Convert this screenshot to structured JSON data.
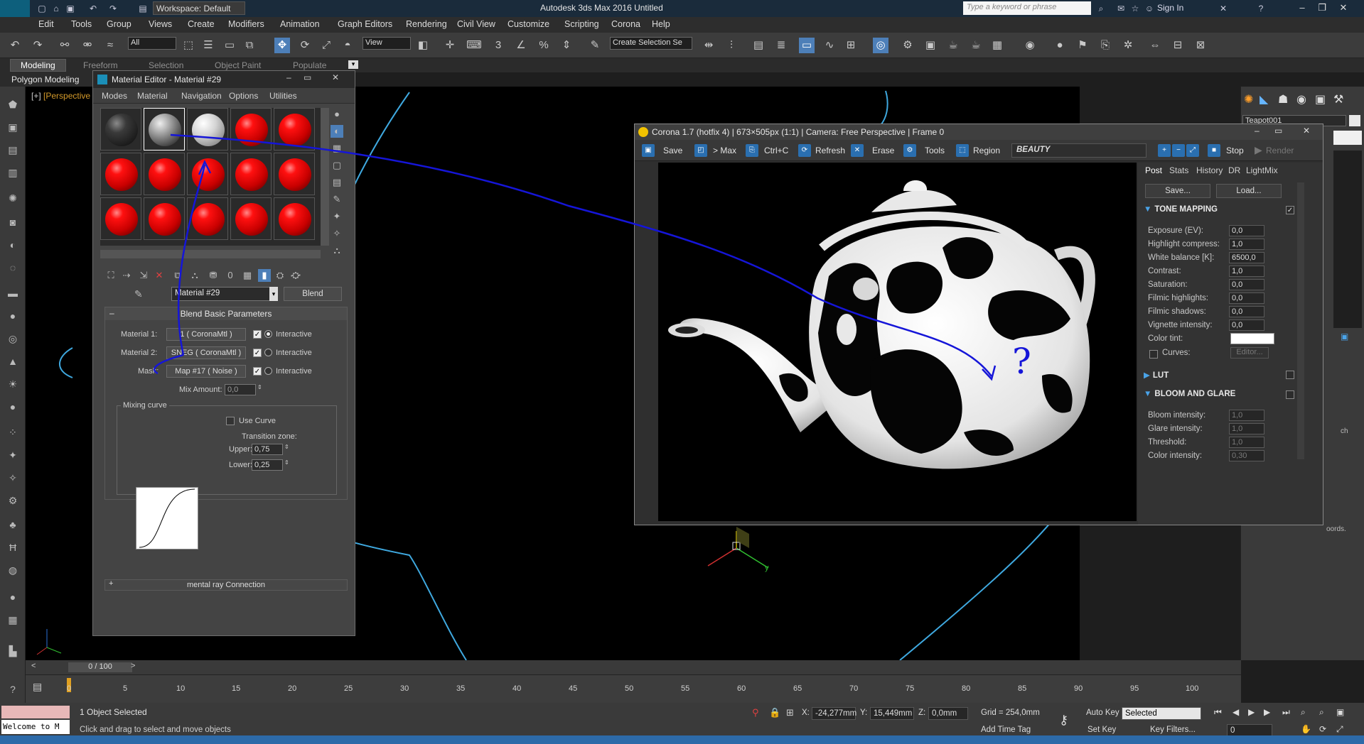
{
  "app": {
    "title": "Autodesk 3ds Max 2016     Untitled",
    "workspace": "Workspace: Default",
    "search_placeholder": "Type a keyword or phrase",
    "sign_in": "Sign In",
    "logo": "MAX"
  },
  "menu": [
    "Edit",
    "Tools",
    "Group",
    "Views",
    "Create",
    "Modifiers",
    "Animation",
    "Graph Editors",
    "Rendering",
    "Civil View",
    "Customize",
    "Scripting",
    "Corona",
    "Help"
  ],
  "toolbar": {
    "filter": "All",
    "ref_coord": "View",
    "selection_set": "Create Selection Se"
  },
  "ribbon": {
    "tabs": [
      "Modeling",
      "Freeform",
      "Selection",
      "Object Paint",
      "Populate"
    ],
    "active": "Modeling",
    "sub": "Polygon Modeling"
  },
  "viewport": {
    "bracket": "[+]",
    "label": "[Perspective",
    "gizmo_axis": "y"
  },
  "command_panel": {
    "object_name": "Teapot001",
    "side_text": "ch",
    "side_text2": "oords."
  },
  "material_editor": {
    "title": "Material Editor - Material #29",
    "menu": [
      "Modes",
      "Material",
      "Navigation",
      "Options",
      "Utilities"
    ],
    "material_name": "Material #29",
    "material_type": "Blend",
    "rollout_title": "Blend Basic Parameters",
    "material1_label": "Material 1:",
    "material1_value": "1  ( CoronaMtl )",
    "material2_label": "Material 2:",
    "material2_value": "SNEG  ( CoronaMtl )",
    "mask_label": "Mask:",
    "mask_value": "Map #17  ( Noise )",
    "interactive": "Interactive",
    "mix_amount_label": "Mix Amount:",
    "mix_amount": "0,0",
    "mixing_curve_label": "Mixing curve",
    "use_curve": "Use Curve",
    "transition_zone": "Transition zone:",
    "upper_label": "Upper:",
    "upper": "0,75",
    "lower_label": "Lower:",
    "lower": "0,25",
    "mental_ray": "mental ray Connection",
    "slots": [
      "dark",
      "noise",
      "white",
      "red",
      "red",
      "red",
      "red",
      "red",
      "red",
      "red",
      "red",
      "red",
      "red",
      "red",
      "red"
    ]
  },
  "vfb": {
    "title": "Corona 1.7 (hotfix 4) | 673×505px (1:1) | Camera: Free Perspective | Frame 0",
    "buttons": [
      "Save",
      "> Max",
      "Ctrl+C",
      "Refresh",
      "Erase",
      "Tools",
      "Region"
    ],
    "channel": "BEAUTY",
    "stop": "Stop",
    "render": "Render",
    "tabs": [
      "Post",
      "Stats",
      "History",
      "DR",
      "LightMix"
    ],
    "save_btn": "Save...",
    "load_btn": "Load...",
    "tone_mapping": "TONE MAPPING",
    "params": [
      {
        "label": "Exposure (EV):",
        "value": "0,0"
      },
      {
        "label": "Highlight compress:",
        "value": "1,0"
      },
      {
        "label": "White balance [K]:",
        "value": "6500,0"
      },
      {
        "label": "Contrast:",
        "value": "1,0"
      },
      {
        "label": "Saturation:",
        "value": "0,0"
      },
      {
        "label": "Filmic highlights:",
        "value": "0,0"
      },
      {
        "label": "Filmic shadows:",
        "value": "0,0"
      },
      {
        "label": "Vignette intensity:",
        "value": "0,0"
      }
    ],
    "color_tint": "Color tint:",
    "curves": "Curves:",
    "editor": "Editor...",
    "lut": "LUT",
    "bloom": "BLOOM AND GLARE",
    "bloom_params": [
      {
        "label": "Bloom intensity:",
        "value": "1,0"
      },
      {
        "label": "Glare intensity:",
        "value": "1,0"
      },
      {
        "label": "Threshold:",
        "value": "1,0"
      },
      {
        "label": "Color intensity:",
        "value": "0,30"
      }
    ],
    "annotation": "?"
  },
  "timeline": {
    "frame": "0 / 100",
    "ticks": [
      "0",
      "5",
      "10",
      "15",
      "20",
      "25",
      "30",
      "35",
      "40",
      "45",
      "50",
      "55",
      "60",
      "65",
      "70",
      "75",
      "80",
      "85",
      "90",
      "95",
      "100"
    ]
  },
  "status": {
    "welcome": "Welcome to M",
    "selected": "1 Object Selected",
    "hint": "Click and drag to select and move objects",
    "x_label": "X:",
    "x": "-24,277mm",
    "y_label": "Y:",
    "y": "15,449mm",
    "z_label": "Z:",
    "z": "0,0mm",
    "grid": "Grid = 254,0mm",
    "add_time_tag": "Add Time Tag",
    "auto_key": "Auto Key",
    "set_key": "Set Key",
    "key_mode": "Selected",
    "key_filters": "Key Filters...",
    "frame_field": "0"
  },
  "colors": {
    "annotation_blue": "#1515d8",
    "selection_cyan": "#3fa9e0",
    "corona_accent": "#2a6fb0"
  }
}
